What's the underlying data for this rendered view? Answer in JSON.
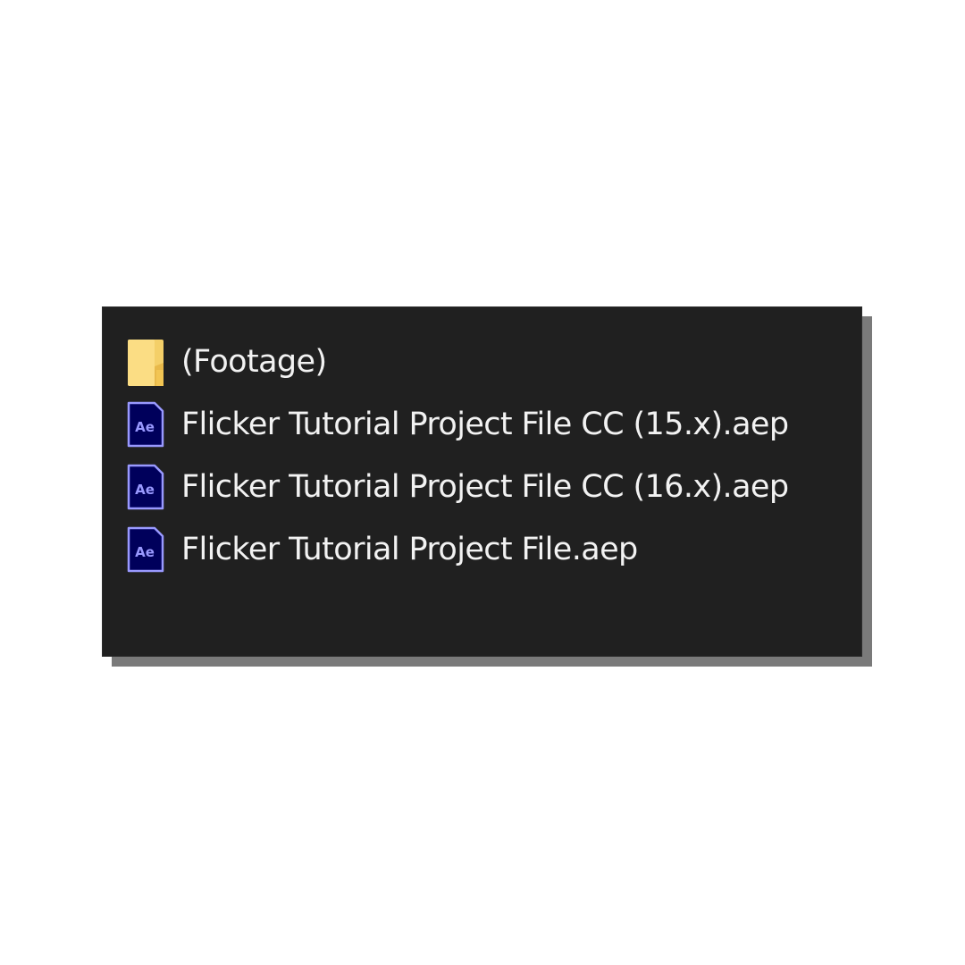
{
  "explorer": {
    "items": [
      {
        "label": "(Footage)",
        "icon": "folder-icon"
      },
      {
        "label": "Flicker Tutorial Project File CC (15.x).aep",
        "icon": "after-effects-file-icon"
      },
      {
        "label": "Flicker Tutorial Project File CC (16.x).aep",
        "icon": "after-effects-file-icon"
      },
      {
        "label": "Flicker Tutorial Project File.aep",
        "icon": "after-effects-file-icon"
      }
    ],
    "ae_icon_text": "Ae"
  },
  "colors": {
    "panel_background": "#202020",
    "text": "#f2f2f2",
    "folder": "#f4cf68",
    "ae_icon_fill": "#00005b",
    "ae_icon_accent": "#9999ff"
  }
}
